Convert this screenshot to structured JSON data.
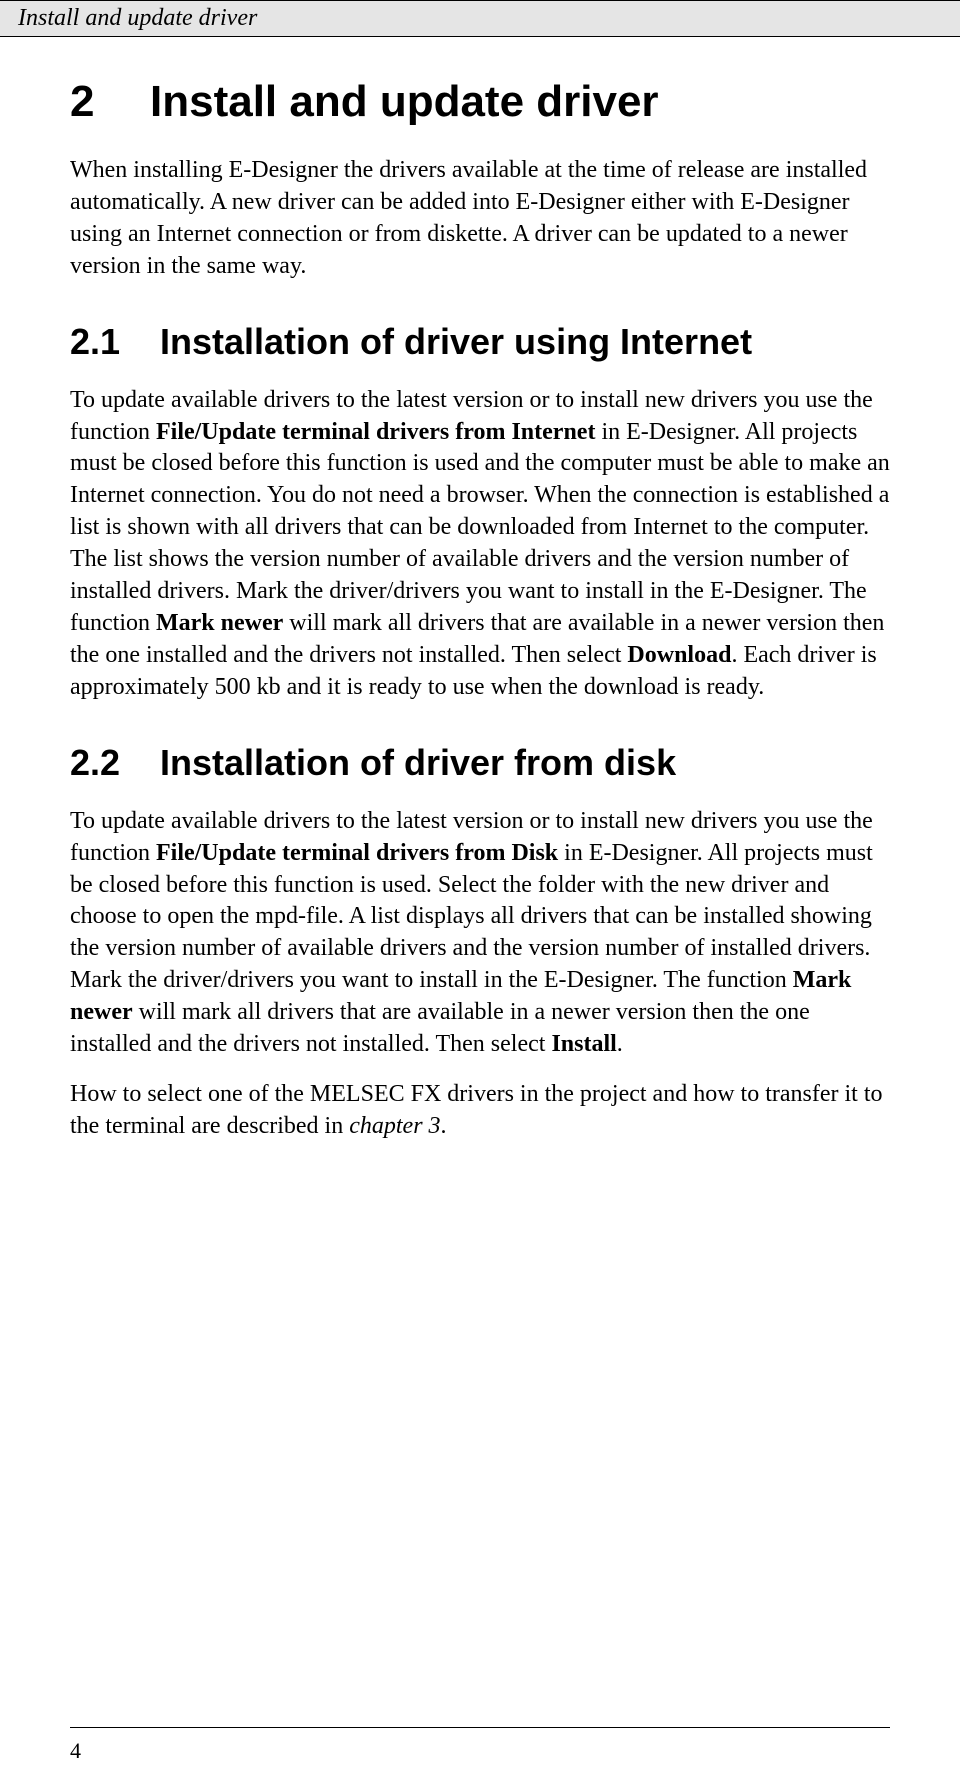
{
  "header": {
    "title": "Install and update driver"
  },
  "h1": {
    "num": "2",
    "text": "Install and update driver"
  },
  "intro": {
    "p1": "When installing E-Designer the drivers available at the time of release are installed automatically. A new driver can be added into E-Designer either with E-Designer using an Internet connection or from diskette. A driver can be updated to a newer version in the same way."
  },
  "s21": {
    "num": "2.1",
    "title": "Installation of driver using Internet",
    "p1a": "To update available drivers to the latest version or to install new drivers you use the function ",
    "p1b": "File/Update terminal drivers from Internet",
    "p1c": " in E-Designer. All projects must be closed before this function is used and the computer must be able to make an Internet connection. You do not need a browser. When the connection is established a list is shown with all drivers that can be downloaded from Internet to the computer. The list shows the version number of available drivers and the version number of installed drivers. Mark the driver/drivers you want to install in the E-Designer. The function ",
    "p1d": "Mark newer",
    "p1e": " will mark all drivers that are available in a newer version then the one installed and the drivers not installed. Then select ",
    "p1f": "Download",
    "p1g": ". Each driver is approximately 500 kb and it is ready to use when the download is ready."
  },
  "s22": {
    "num": "2.2",
    "title": "Installation of driver from disk",
    "p1a": "To update available drivers to the latest version or to install new drivers you use the function ",
    "p1b": "File/Update terminal drivers from Disk",
    "p1c": " in E-Designer. All projects must be closed before this function is used. Select the folder with the new driver and choose to open the mpd-file. A list displays all drivers that can be installed showing the version number of available drivers and the version number of installed drivers. Mark the driver/drivers you want to install in the E-Designer. The function ",
    "p1d": "Mark newer",
    "p1e": " will mark all drivers that are available in a newer version then the one installed and the drivers not installed. Then select ",
    "p1f": "Install",
    "p1g": ".",
    "p2a": "How to select one of the MELSEC FX drivers in the project and how to transfer it to the terminal are described in ",
    "p2b": "chapter 3",
    "p2c": "."
  },
  "footer": {
    "page": "4"
  }
}
